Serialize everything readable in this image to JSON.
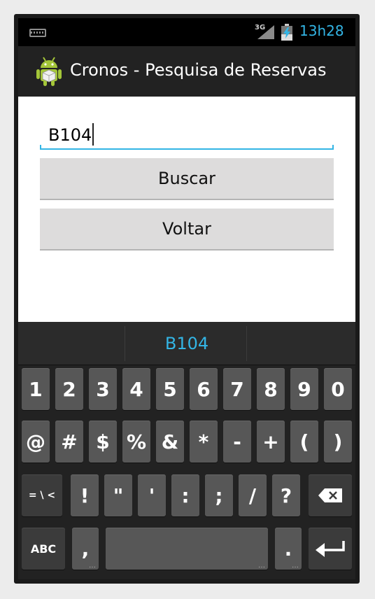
{
  "status_bar": {
    "network": "3G",
    "time": "13h28",
    "icons": [
      "keyboard-notification-icon",
      "signal-icon",
      "battery-icon"
    ]
  },
  "action_bar": {
    "title": "Cronos - Pesquisa de Reservas",
    "icon": "android-app-icon"
  },
  "form": {
    "search_value": "B104",
    "search_button_label": "Buscar",
    "back_button_label": "Voltar"
  },
  "keyboard": {
    "suggestion": "B104",
    "row1": [
      "1",
      "2",
      "3",
      "4",
      "5",
      "6",
      "7",
      "8",
      "9",
      "0"
    ],
    "row2": [
      "@",
      "#",
      "$",
      "%",
      "&",
      "*",
      "-",
      "+",
      "(",
      ")"
    ],
    "row3_left": "= \\ <",
    "row3": [
      "!",
      "\"",
      "'",
      ":",
      ";",
      "/",
      "?"
    ],
    "row4_left": "ABC",
    "row4_comma": ",",
    "row4_period": "."
  },
  "colors": {
    "accent": "#33b5e5",
    "action_bar": "#222222",
    "keyboard_bg": "#222222",
    "key": "#575757",
    "button": "#dddcdc"
  }
}
